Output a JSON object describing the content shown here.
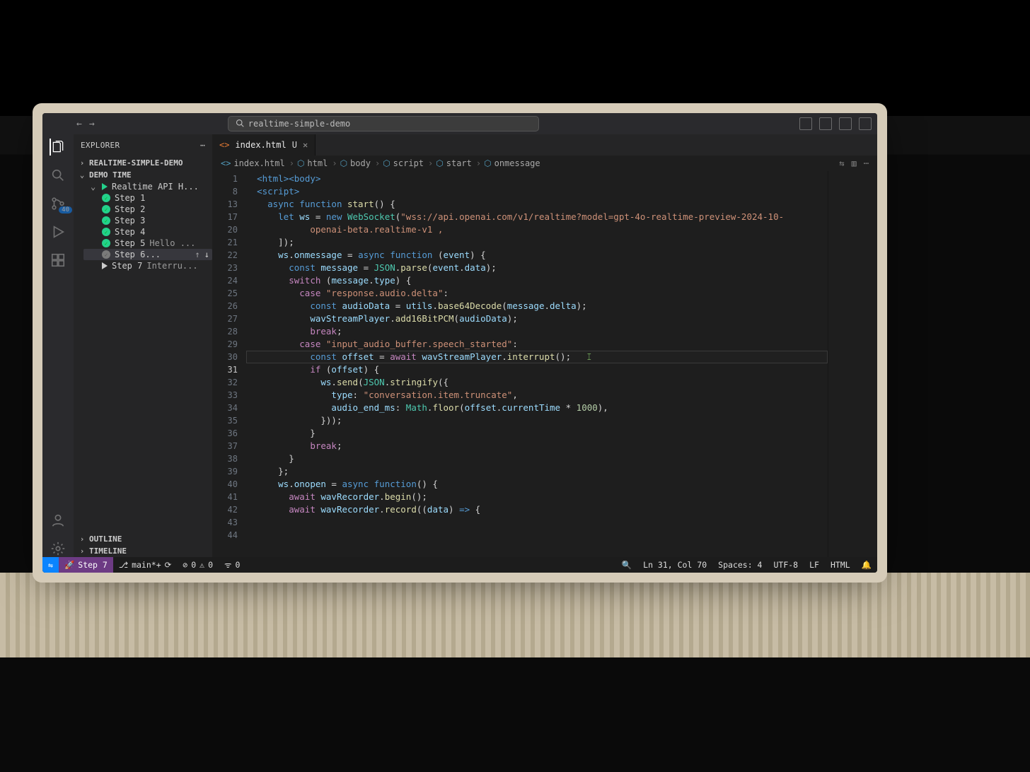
{
  "titlebar": {
    "search_text": "realtime-simple-demo"
  },
  "activity": {
    "scm_badge": "40"
  },
  "explorer": {
    "title": "EXPLORER",
    "folders": [
      {
        "label": "REALTIME-SIMPLE-DEMO",
        "expanded": false
      },
      {
        "label": "DEMO TIME",
        "expanded": true
      }
    ],
    "demo": {
      "root": "Realtime API H...",
      "steps": [
        {
          "label": "Step 1",
          "done": true
        },
        {
          "label": "Step 2",
          "done": true
        },
        {
          "label": "Step 3",
          "done": true
        },
        {
          "label": "Step 4",
          "done": true
        },
        {
          "label": "Step 5",
          "suffix": "Hello ...",
          "done": true
        },
        {
          "label": "Step 6...",
          "done": true,
          "sel": true,
          "arrows": true
        },
        {
          "label": "Step 7",
          "suffix": "Interru...",
          "done": false
        }
      ]
    },
    "outline": "OUTLINE",
    "timeline": "TIMELINE"
  },
  "tab": {
    "filename": "index.html",
    "modified": "U"
  },
  "breadcrumbs": [
    "index.html",
    "html",
    "body",
    "script",
    "start",
    "onmessage"
  ],
  "code": {
    "line_numbers": [
      1,
      8,
      13,
      17,
      20,
      21,
      22,
      23,
      24,
      25,
      26,
      27,
      28,
      29,
      30,
      31,
      32,
      33,
      34,
      35,
      36,
      37,
      38,
      39,
      40,
      41,
      42,
      43,
      44
    ],
    "current_line": 31,
    "lines": [
      [
        [
          "  ",
          "p"
        ],
        [
          "<",
          "t-tag"
        ],
        [
          "html",
          "t-tag"
        ],
        [
          ">",
          "t-tag"
        ],
        [
          "<",
          "t-tag"
        ],
        [
          "body",
          "t-tag"
        ],
        [
          ">",
          "t-tag"
        ]
      ],
      [
        [
          "  ",
          "p"
        ],
        [
          "<",
          "t-tag"
        ],
        [
          "script",
          "t-tag"
        ],
        [
          ">",
          "t-tag"
        ]
      ],
      [
        [
          "    ",
          "p"
        ],
        [
          "async function ",
          "t-key"
        ],
        [
          "start",
          "t-fn"
        ],
        [
          "() {",
          "p"
        ]
      ],
      [
        [
          "      ",
          "p"
        ],
        [
          "let ",
          "t-key"
        ],
        [
          "ws",
          "t-id"
        ],
        [
          " = ",
          "p"
        ],
        [
          "new ",
          "t-key"
        ],
        [
          "WebSocket",
          "t-ty"
        ],
        [
          "(",
          "p"
        ],
        [
          "\"wss://api.openai.com/v1/realtime?model=gpt-4o-realtime-preview-2024-10-",
          "t-str"
        ]
      ],
      [
        [
          "            ",
          "p"
        ],
        [
          "openai-beta.realtime-v1 ,",
          "t-str"
        ]
      ],
      [
        [
          "      ]);",
          "p"
        ]
      ],
      [
        [
          "",
          "p"
        ]
      ],
      [
        [
          "      ",
          "p"
        ],
        [
          "ws",
          "t-id"
        ],
        [
          ".",
          "p"
        ],
        [
          "onmessage",
          "t-id"
        ],
        [
          " = ",
          "p"
        ],
        [
          "async function ",
          "t-key"
        ],
        [
          "(",
          "p"
        ],
        [
          "event",
          "t-id"
        ],
        [
          ") {",
          "p"
        ]
      ],
      [
        [
          "        ",
          "p"
        ],
        [
          "const ",
          "t-key"
        ],
        [
          "message",
          "t-id"
        ],
        [
          " = ",
          "p"
        ],
        [
          "JSON",
          "t-ty"
        ],
        [
          ".",
          "p"
        ],
        [
          "parse",
          "t-fn"
        ],
        [
          "(",
          "p"
        ],
        [
          "event",
          "t-id"
        ],
        [
          ".",
          "p"
        ],
        [
          "data",
          "t-id"
        ],
        [
          ");",
          "p"
        ]
      ],
      [
        [
          "        ",
          "p"
        ],
        [
          "switch ",
          "t-kw"
        ],
        [
          "(",
          "p"
        ],
        [
          "message",
          "t-id"
        ],
        [
          ".",
          "p"
        ],
        [
          "type",
          "t-id"
        ],
        [
          ") {",
          "p"
        ]
      ],
      [
        [
          "          ",
          "p"
        ],
        [
          "case ",
          "t-kw"
        ],
        [
          "\"response.audio.delta\"",
          "t-str"
        ],
        [
          ":",
          "p"
        ]
      ],
      [
        [
          "            ",
          "p"
        ],
        [
          "const ",
          "t-key"
        ],
        [
          "audioData",
          "t-id"
        ],
        [
          " = ",
          "p"
        ],
        [
          "utils",
          "t-id"
        ],
        [
          ".",
          "p"
        ],
        [
          "base64Decode",
          "t-fn"
        ],
        [
          "(",
          "p"
        ],
        [
          "message",
          "t-id"
        ],
        [
          ".",
          "p"
        ],
        [
          "delta",
          "t-id"
        ],
        [
          ");",
          "p"
        ]
      ],
      [
        [
          "            ",
          "p"
        ],
        [
          "wavStreamPlayer",
          "t-id"
        ],
        [
          ".",
          "p"
        ],
        [
          "add16BitPCM",
          "t-fn"
        ],
        [
          "(",
          "p"
        ],
        [
          "audioData",
          "t-id"
        ],
        [
          ");",
          "p"
        ]
      ],
      [
        [
          "            ",
          "p"
        ],
        [
          "break",
          "t-kw"
        ],
        [
          ";",
          "p"
        ]
      ],
      [
        [
          "          ",
          "p"
        ],
        [
          "case ",
          "t-kw"
        ],
        [
          "\"input_audio_buffer.speech_started\"",
          "t-str"
        ],
        [
          ":",
          "p"
        ]
      ],
      [
        [
          "            ",
          "p"
        ],
        [
          "const ",
          "t-key"
        ],
        [
          "offset",
          "t-id"
        ],
        [
          " = ",
          "p"
        ],
        [
          "await ",
          "t-kw"
        ],
        [
          "wavStreamPlayer",
          "t-id"
        ],
        [
          ".",
          "p"
        ],
        [
          "interrupt",
          "t-fn"
        ],
        [
          "();   ",
          "p"
        ],
        [
          "ꕯ",
          "t-cm"
        ]
      ],
      [
        [
          "            ",
          "p"
        ],
        [
          "if ",
          "t-kw"
        ],
        [
          "(",
          "p"
        ],
        [
          "offset",
          "t-id"
        ],
        [
          ") {",
          "p"
        ]
      ],
      [
        [
          "              ",
          "p"
        ],
        [
          "ws",
          "t-id"
        ],
        [
          ".",
          "p"
        ],
        [
          "send",
          "t-fn"
        ],
        [
          "(",
          "p"
        ],
        [
          "JSON",
          "t-ty"
        ],
        [
          ".",
          "p"
        ],
        [
          "stringify",
          "t-fn"
        ],
        [
          "({",
          "p"
        ]
      ],
      [
        [
          "                ",
          "p"
        ],
        [
          "type",
          "t-id"
        ],
        [
          ": ",
          "p"
        ],
        [
          "\"conversation.item.truncate\"",
          "t-str"
        ],
        [
          ",",
          "p"
        ]
      ],
      [
        [
          "                ",
          "p"
        ],
        [
          "audio_end_ms",
          "t-id"
        ],
        [
          ": ",
          "p"
        ],
        [
          "Math",
          "t-ty"
        ],
        [
          ".",
          "p"
        ],
        [
          "floor",
          "t-fn"
        ],
        [
          "(",
          "p"
        ],
        [
          "offset",
          "t-id"
        ],
        [
          ".",
          "p"
        ],
        [
          "currentTime",
          "t-id"
        ],
        [
          " * ",
          "p"
        ],
        [
          "1000",
          "t-num"
        ],
        [
          "),",
          "p"
        ]
      ],
      [
        [
          "              }));",
          "p"
        ]
      ],
      [
        [
          "            }",
          "p"
        ]
      ],
      [
        [
          "            ",
          "p"
        ],
        [
          "break",
          "t-kw"
        ],
        [
          ";",
          "p"
        ]
      ],
      [
        [
          "        }",
          "p"
        ]
      ],
      [
        [
          "      };",
          "p"
        ]
      ],
      [
        [
          "",
          "p"
        ]
      ],
      [
        [
          "      ",
          "p"
        ],
        [
          "ws",
          "t-id"
        ],
        [
          ".",
          "p"
        ],
        [
          "onopen",
          "t-id"
        ],
        [
          " = ",
          "p"
        ],
        [
          "async function",
          "t-key"
        ],
        [
          "() {",
          "p"
        ]
      ],
      [
        [
          "        ",
          "p"
        ],
        [
          "await ",
          "t-kw"
        ],
        [
          "wavRecorder",
          "t-id"
        ],
        [
          ".",
          "p"
        ],
        [
          "begin",
          "t-fn"
        ],
        [
          "();",
          "p"
        ]
      ],
      [
        [
          "        ",
          "p"
        ],
        [
          "await ",
          "t-kw"
        ],
        [
          "wavRecorder",
          "t-id"
        ],
        [
          ".",
          "p"
        ],
        [
          "record",
          "t-fn"
        ],
        [
          "((",
          "p"
        ],
        [
          "data",
          "t-id"
        ],
        [
          ") ",
          "p"
        ],
        [
          "=>",
          "t-key"
        ],
        [
          " {",
          "p"
        ]
      ]
    ]
  },
  "status": {
    "step": "Step 7",
    "branch": "main*+",
    "sync": "⟳",
    "errors": "0",
    "warnings": "0",
    "ports": "0",
    "cursor": "Ln 31, Col 70",
    "spaces": "Spaces: 4",
    "encoding": "UTF-8",
    "eol": "LF",
    "lang": "HTML"
  }
}
